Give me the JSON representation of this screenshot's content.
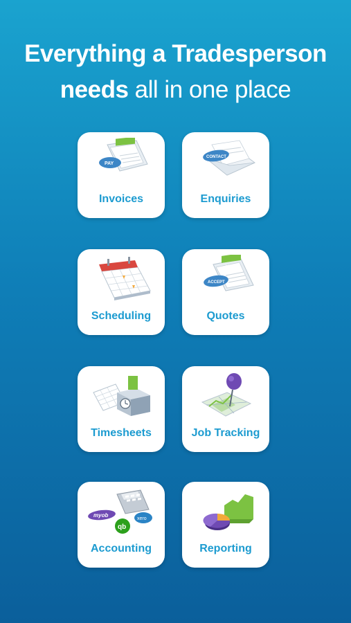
{
  "headline": {
    "line1": "Everything a Tradesperson",
    "line2_bold": "needs",
    "line2_rest": " all in one place"
  },
  "tiles": [
    {
      "label": "Invoices",
      "icon": "invoice-icon"
    },
    {
      "label": "Enquiries",
      "icon": "enquiry-envelope-icon"
    },
    {
      "label": "Scheduling",
      "icon": "calendar-icon"
    },
    {
      "label": "Quotes",
      "icon": "quote-icon"
    },
    {
      "label": "Timesheets",
      "icon": "timesheet-icon"
    },
    {
      "label": "Job Tracking",
      "icon": "map-pin-icon"
    },
    {
      "label": "Accounting",
      "icon": "calculator-icon"
    },
    {
      "label": "Reporting",
      "icon": "pie-chart-icon"
    }
  ],
  "icon_text": {
    "volt": "VOLT",
    "pay": "PAY",
    "contact": "CONTACT",
    "accept": "ACCEPT",
    "myob": "myob",
    "qb": "qb",
    "xero": "xero"
  },
  "colors": {
    "background_top": "#1aa3cf",
    "background_bottom": "#0b5f9b",
    "label": "#1c9bd0",
    "accent_green": "#7cc242",
    "accent_blue": "#3d86c6",
    "accent_purple": "#6f4ab3"
  }
}
